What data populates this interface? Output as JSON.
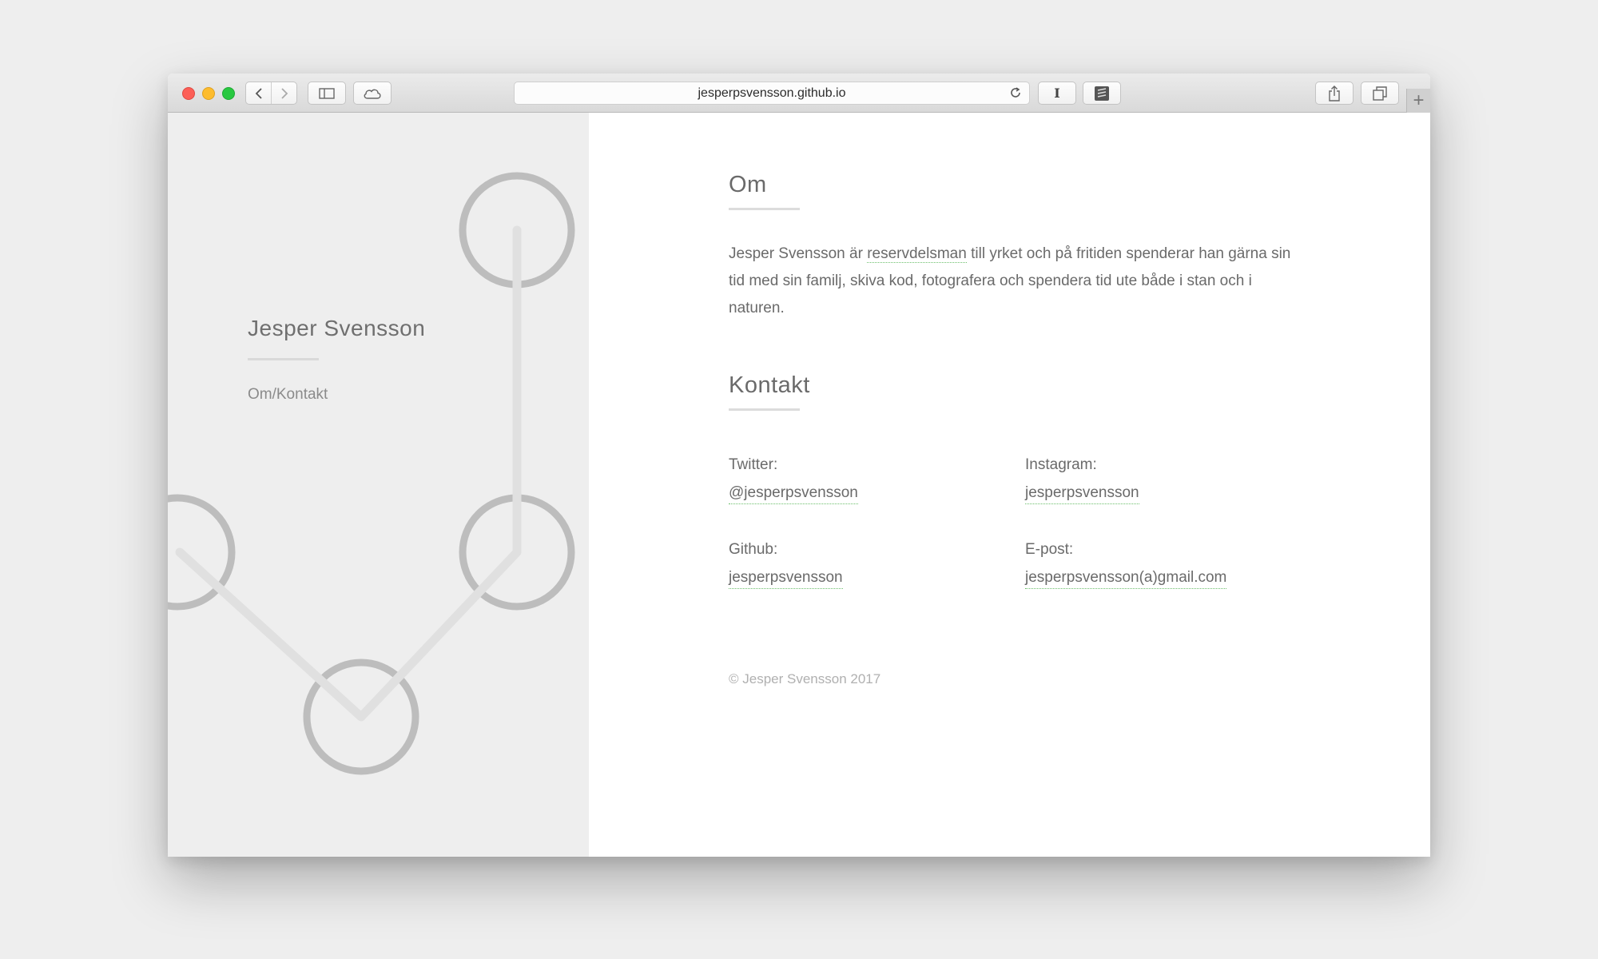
{
  "browser": {
    "url": "jesperpsvensson.github.io",
    "reader_button": "I",
    "new_tab_button": "+"
  },
  "sidebar": {
    "site_title": "Jesper Svensson",
    "nav_link": "Om/Kontakt"
  },
  "about": {
    "heading": "Om",
    "text_before": "Jesper Svensson är ",
    "link_text": "reservdelsman",
    "text_after": " till yrket och på fritiden spenderar han gärna sin tid med sin familj, skiva kod, fotografera och spendera tid ute både i stan och i naturen."
  },
  "contact": {
    "heading": "Kontakt",
    "items": [
      {
        "label": "Twitter:",
        "value": "@jesperpsvensson"
      },
      {
        "label": "Instagram:",
        "value": "jesperpsvensson"
      },
      {
        "label": "Github:",
        "value": "jesperpsvensson"
      },
      {
        "label": "E-post:",
        "value": "jesperpsvensson(a)gmail.com"
      }
    ]
  },
  "footer": {
    "copyright": "© Jesper Svensson 2017"
  },
  "colors": {
    "sidebar_bg": "#eeeeee",
    "link_underline": "#6cbf6c",
    "text": "#6a6a6a",
    "decor_circle": "#bdbdbd",
    "decor_line": "#e0e0e0"
  }
}
